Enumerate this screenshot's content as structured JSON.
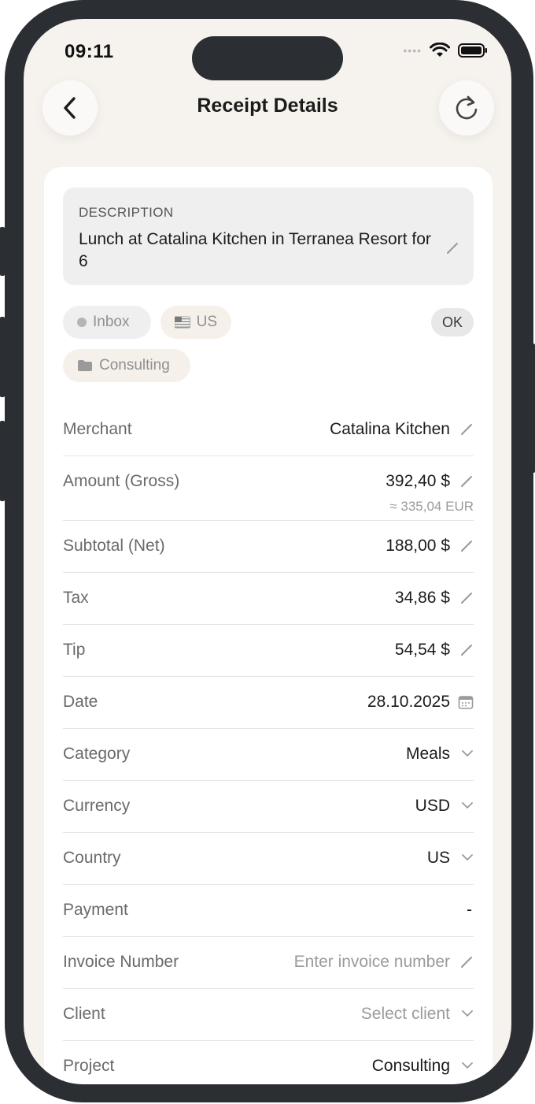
{
  "status": {
    "time": "09:11"
  },
  "nav": {
    "title": "Receipt Details"
  },
  "description": {
    "label": "DESCRIPTION",
    "text": "Lunch at Catalina Kitchen in Terranea Resort for 6"
  },
  "chips": {
    "inbox": "Inbox",
    "country": "US",
    "project": "Consulting",
    "ok": "OK"
  },
  "fields": {
    "merchant": {
      "label": "Merchant",
      "value": "Catalina Kitchen"
    },
    "amount": {
      "label": "Amount (Gross)",
      "value": "392,40 $",
      "converted": "≈ 335,04 EUR"
    },
    "subtotal": {
      "label": "Subtotal (Net)",
      "value": "188,00 $"
    },
    "tax": {
      "label": "Tax",
      "value": "34,86 $"
    },
    "tip": {
      "label": "Tip",
      "value": "54,54 $"
    },
    "date": {
      "label": "Date",
      "value": "28.10.2025"
    },
    "category": {
      "label": "Category",
      "value": "Meals"
    },
    "currency": {
      "label": "Currency",
      "value": "USD"
    },
    "country": {
      "label": "Country",
      "value": "US"
    },
    "payment": {
      "label": "Payment",
      "value": "-"
    },
    "invoice": {
      "label": "Invoice Number",
      "placeholder": "Enter invoice number"
    },
    "client": {
      "label": "Client",
      "placeholder": "Select client"
    },
    "project": {
      "label": "Project",
      "value": "Consulting"
    }
  },
  "colors": {
    "frame": "#2b2e32",
    "background": "#f6f2ee",
    "card": "#ffffff",
    "description_bg": "#efefef"
  }
}
